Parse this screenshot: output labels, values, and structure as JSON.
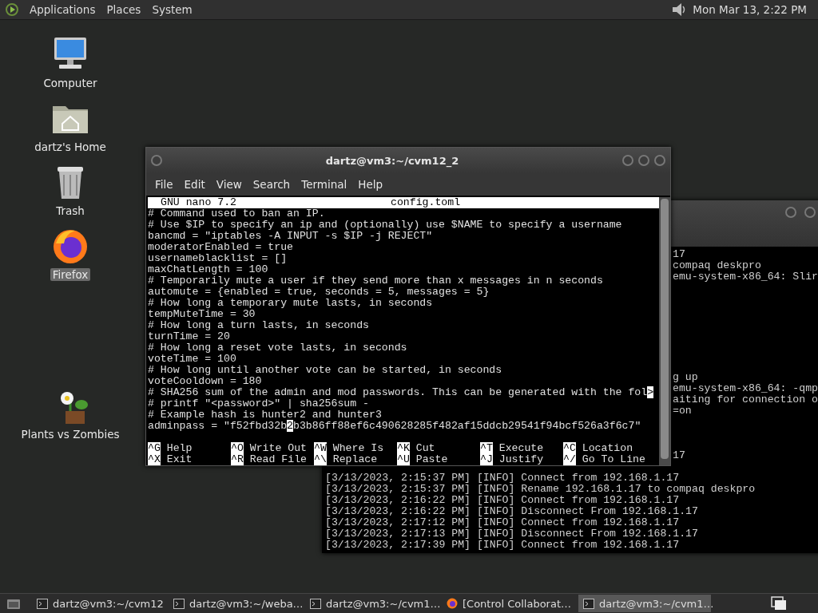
{
  "top_panel": {
    "menus": [
      "Applications",
      "Places",
      "System"
    ],
    "clock": "Mon Mar 13,  2:22 PM"
  },
  "desktop_icons": [
    {
      "kind": "computer",
      "label": "Computer",
      "selected": false
    },
    {
      "kind": "home",
      "label": "dartz's Home",
      "selected": false
    },
    {
      "kind": "trash",
      "label": "Trash",
      "selected": false
    },
    {
      "kind": "browser",
      "label": "Firefox",
      "selected": true
    },
    {
      "kind": "game",
      "label": "Plants vs Zombies",
      "selected": false
    }
  ],
  "back_terminal": {
    "fragment_blocks": [
      [
        "17",
        "compaq deskpro",
        "emu-system-x86_64: Slir"
      ],
      [
        "g up",
        "emu-system-x86_64: -qmp",
        "aiting for connection o",
        "=on"
      ],
      [
        "17"
      ]
    ],
    "log_lines": [
      "[3/13/2023, 2:15:37 PM] [INFO] Connect from 192.168.1.17",
      "[3/13/2023, 2:15:37 PM] [INFO] Rename 192.168.1.17 to compaq deskpro",
      "[3/13/2023, 2:16:22 PM] [INFO] Connect from 192.168.1.17",
      "[3/13/2023, 2:16:22 PM] [INFO] Disconnect From 192.168.1.17",
      "[3/13/2023, 2:17:12 PM] [INFO] Connect from 192.168.1.17",
      "[3/13/2023, 2:17:13 PM] [INFO] Disconnect From 192.168.1.17",
      "[3/13/2023, 2:17:39 PM] [INFO] Connect from 192.168.1.17"
    ]
  },
  "nano_window": {
    "title": "dartz@vm3:~/cvm12_2",
    "menu": [
      "File",
      "Edit",
      "View",
      "Search",
      "Terminal",
      "Help"
    ],
    "header": {
      "version": "GNU nano 7.2",
      "filename": "config.toml"
    },
    "lines": [
      {
        "kind": "plain",
        "text": "# Command used to ban an IP."
      },
      {
        "kind": "plain",
        "text": "# Use $IP to specify an ip and (optionally) use $NAME to specify a username"
      },
      {
        "kind": "plain",
        "text": "bancmd = \"iptables -A INPUT -s $IP -j REJECT\""
      },
      {
        "kind": "plain",
        "text": "moderatorEnabled = true"
      },
      {
        "kind": "plain",
        "text": "usernameblacklist = []"
      },
      {
        "kind": "plain",
        "text": "maxChatLength = 100"
      },
      {
        "kind": "plain",
        "text": "# Temporarily mute a user if they send more than x messages in n seconds"
      },
      {
        "kind": "plain",
        "text": "automute = {enabled = true, seconds = 5, messages = 5}"
      },
      {
        "kind": "plain",
        "text": "# How long a temporary mute lasts, in seconds"
      },
      {
        "kind": "plain",
        "text": "tempMuteTime = 30"
      },
      {
        "kind": "plain",
        "text": "# How long a turn lasts, in seconds"
      },
      {
        "kind": "plain",
        "text": "turnTime = 20"
      },
      {
        "kind": "plain",
        "text": "# How long a reset vote lasts, in seconds"
      },
      {
        "kind": "plain",
        "text": "voteTime = 100"
      },
      {
        "kind": "plain",
        "text": "# How long until another vote can be started, in seconds"
      },
      {
        "kind": "plain",
        "text": "voteCooldown = 180"
      },
      {
        "kind": "overflow",
        "text": "# SHA256 sum of the admin and mod passwords. This can be generated with the fol",
        "mark": ">"
      },
      {
        "kind": "plain",
        "text": "# printf \"<password>\" | sha256sum -"
      },
      {
        "kind": "plain",
        "text": "# Example hash is hunter2 and hunter3"
      },
      {
        "kind": "cursor",
        "before": "adminpass = \"f52fbd32b",
        "cursor": "2",
        "after": "b3b86ff88ef6c490628285f482af15ddcb29541f94bcf526a3f6c7\""
      }
    ],
    "shortcuts": [
      [
        {
          "key": "^G",
          "label": "Help"
        },
        {
          "key": "^O",
          "label": "Write Out"
        },
        {
          "key": "^W",
          "label": "Where Is"
        },
        {
          "key": "^K",
          "label": "Cut"
        },
        {
          "key": "^T",
          "label": "Execute"
        },
        {
          "key": "^C",
          "label": "Location"
        }
      ],
      [
        {
          "key": "^X",
          "label": "Exit"
        },
        {
          "key": "^R",
          "label": "Read File"
        },
        {
          "key": "^\\",
          "label": "Replace"
        },
        {
          "key": "^U",
          "label": "Paste"
        },
        {
          "key": "^J",
          "label": "Justify"
        },
        {
          "key": "^/",
          "label": "Go To Line"
        }
      ]
    ]
  },
  "taskbar": {
    "tasks": [
      {
        "kind": "terminal",
        "label": "dartz@vm3:~/cvm12",
        "selected": false
      },
      {
        "kind": "terminal",
        "label": "dartz@vm3:~/weba…",
        "selected": false
      },
      {
        "kind": "terminal",
        "label": "dartz@vm3:~/cvm1…",
        "selected": false
      },
      {
        "kind": "browser",
        "label": "[Control Collaborat…",
        "selected": false
      },
      {
        "kind": "terminal",
        "label": "dartz@vm3:~/cvm1…",
        "selected": true
      }
    ]
  }
}
